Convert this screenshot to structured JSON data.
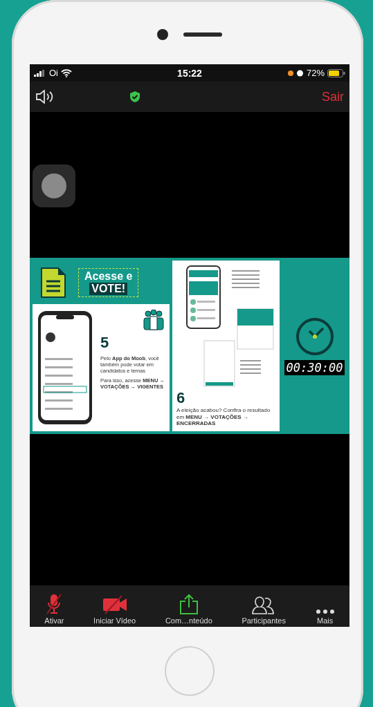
{
  "status_bar": {
    "carrier": "Oi",
    "time": "15:22",
    "battery": "72%"
  },
  "top_bar": {
    "leave": "Sair"
  },
  "shared_slide": {
    "title_line_1": "Acesse e",
    "title_line_2": "VOTE!",
    "step_5": {
      "number": "5",
      "text": "Pelo **App do Moob**, você também pode votar em candidatos e temas",
      "path": "Para isso, acesse **MENU → VOTAÇÕES → VIGENTES**"
    },
    "step_6": {
      "number": "6",
      "text": "A eleição acabou? Confira o resultado em **MENU → VOTAÇÕES → ENCERRADAS**"
    },
    "timer": "00:30:00"
  },
  "toolbar": [
    {
      "kind": "mic",
      "label": "Ativar"
    },
    {
      "kind": "video",
      "label": "Iniciar Vídeo"
    },
    {
      "kind": "share",
      "label": "Com…nteúdo"
    },
    {
      "kind": "participants",
      "label": "Participantes"
    },
    {
      "kind": "more",
      "label": "Mais"
    }
  ]
}
